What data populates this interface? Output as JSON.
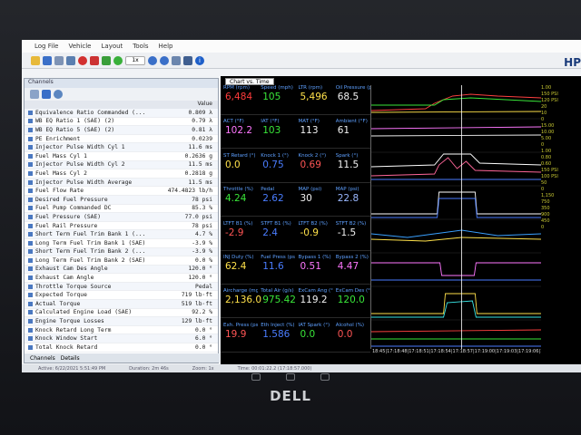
{
  "menu": [
    "Log File",
    "Vehicle",
    "Layout",
    "Tools",
    "Help"
  ],
  "toolbar_icons": [
    "open-icon",
    "save-icon",
    "vehicle-icon",
    "disconnect-icon",
    "record-icon",
    "stop-icon",
    "bookmark-icon",
    "play-icon",
    "speed-icon",
    "zoom-in-icon",
    "zoom-out-icon",
    "chart-icon",
    "layout-icon",
    "info-icon"
  ],
  "toolbar_speed": "1x",
  "app_logo": "HP",
  "channels": {
    "title": "Channels",
    "value_header": "Value",
    "rows": [
      {
        "name": "Equivalence Ratio Commanded (...",
        "value": "0.809 λ"
      },
      {
        "name": "WB EQ Ratio 1 (SAE) (2)",
        "value": "0.79 λ"
      },
      {
        "name": "WB EQ Ratio 5 (SAE) (2)",
        "value": "0.81 λ"
      },
      {
        "name": "PE Enrichment",
        "value": "0.0239"
      },
      {
        "name": "Injector Pulse Width Cyl 1",
        "value": "11.6 ms"
      },
      {
        "name": "Fuel Mass Cyl 1",
        "value": "0.2636 g"
      },
      {
        "name": "Injector Pulse Width Cyl 2",
        "value": "11.5 ms"
      },
      {
        "name": "Fuel Mass Cyl 2",
        "value": "0.2818 g"
      },
      {
        "name": "Injector Pulse Width Average",
        "value": "11.5 ms"
      },
      {
        "name": "Fuel Flow Rate",
        "value": "474.4823 lb/h"
      },
      {
        "name": "Desired Fuel Pressure",
        "value": "78 psi"
      },
      {
        "name": "Fuel Pump Commanded DC",
        "value": "85.3 %"
      },
      {
        "name": "Fuel Pressure (SAE)",
        "value": "77.0 psi"
      },
      {
        "name": "Fuel Rail Pressure",
        "value": "78 psi"
      },
      {
        "name": "Short Term Fuel Trim Bank 1 (...",
        "value": "4.7 %"
      },
      {
        "name": "Long Term Fuel Trim Bank 1 (SAE)",
        "value": "-3.9 %"
      },
      {
        "name": "Short Term Fuel Trim Bank 2 (...",
        "value": "-3.9 %"
      },
      {
        "name": "Long Term Fuel Trim Bank 2 (SAE)",
        "value": "0.0 %"
      },
      {
        "name": "Exhaust Cam Des Angle",
        "value": "120.0 °"
      },
      {
        "name": "Exhaust Cam Angle",
        "value": "120.0 °"
      },
      {
        "name": "Throttle Torque Source",
        "value": "Pedal"
      },
      {
        "name": "Expected Torque",
        "value": "719 lb·ft"
      },
      {
        "name": "Actual Torque",
        "value": "519 lb·ft"
      },
      {
        "name": "Calculated Engine Load (SAE)",
        "value": "92.2 %"
      },
      {
        "name": "Engine Torque Losses",
        "value": "129 lb·ft"
      },
      {
        "name": "Knock Retard Long Term",
        "value": "0.0 °"
      },
      {
        "name": "Knock Window Start",
        "value": "6.0 °"
      },
      {
        "name": "Total Knock Retard",
        "value": "0.0 °"
      }
    ],
    "tabs": [
      "Channels",
      "Details"
    ]
  },
  "chart_tab": "Chart vs. Time",
  "gauges": [
    [
      {
        "label": "RPM (rpm)",
        "value": "6,484",
        "color": "#ff3b3b"
      },
      {
        "label": "Speed (mph)",
        "value": "105",
        "color": "#39e639"
      },
      {
        "label": "LTR (rpm)",
        "value": "5,496",
        "color": "#ffe14a"
      },
      {
        "label": "Oil Pressure (psi)",
        "value": "68.5",
        "color": "#f2f2f2"
      }
    ],
    [
      {
        "label": "ACT (°F)",
        "value": "102.2",
        "color": "#ff77ff"
      },
      {
        "label": "IAT (°F)",
        "value": "103",
        "color": "#39e639"
      },
      {
        "label": "MAT (°F)",
        "value": "113",
        "color": "#f2f2f2"
      },
      {
        "label": "Ambient (°F)",
        "value": "61",
        "color": "#f2f2f2"
      }
    ],
    [
      {
        "label": "ST Retard (°)",
        "value": "0.0",
        "color": "#ffe14a"
      },
      {
        "label": "Knock 1 (°)",
        "value": "0.75",
        "color": "#4a7dff"
      },
      {
        "label": "Knock 2 (°)",
        "value": "0.69",
        "color": "#ff5555"
      },
      {
        "label": "Spark (°)",
        "value": "11.5",
        "color": "#f2f2f2"
      }
    ],
    [
      {
        "label": "Throttle (%)",
        "value": "4.24",
        "color": "#39e639"
      },
      {
        "label": "Pedal",
        "value": "2.62",
        "color": "#4a7dff"
      },
      {
        "label": "MAP (psi)",
        "value": "30",
        "color": "#f2f2f2"
      },
      {
        "label": "MAP (psi)",
        "value": "22.8",
        "color": "#9ab8ff"
      }
    ],
    [
      {
        "label": "LTFT B1 (%)",
        "value": "-2.9",
        "color": "#ff5555"
      },
      {
        "label": "STFT B1 (%)",
        "value": "2.4",
        "color": "#4a7dff"
      },
      {
        "label": "LTFT B2 (%)",
        "value": "-0.9",
        "color": "#ffe14a"
      },
      {
        "label": "STFT B2 (%)",
        "value": "-1.5",
        "color": "#f2f2f2"
      }
    ],
    [
      {
        "label": "INJ Duty (%)",
        "value": "62.4",
        "color": "#ffe14a"
      },
      {
        "label": "Fuel Press (psi)",
        "value": "11.6",
        "color": "#4a7dff"
      },
      {
        "label": "Bypass 1 (%)",
        "value": "0.51",
        "color": "#ff77ff"
      },
      {
        "label": "Bypass 2 (%)",
        "value": "4.47",
        "color": "#ff77ff"
      }
    ],
    [
      {
        "label": "Aircharge (mg)",
        "value": "2,136.0",
        "color": "#ffe14a"
      },
      {
        "label": "Total Air (g/s)",
        "value": "975.42",
        "color": "#39e639"
      },
      {
        "label": "ExCam Ang (°)",
        "value": "119.2",
        "color": "#f2f2f2"
      },
      {
        "label": "ExCam Des (°)",
        "value": "120.0",
        "color": "#39e639"
      }
    ],
    [
      {
        "label": "Exh. Press (psi)",
        "value": "19.9",
        "color": "#ff5555"
      },
      {
        "label": "Eth Inject (%)",
        "value": "1.586",
        "color": "#4a7dff"
      },
      {
        "label": "IAT Spark (°)",
        "value": "0.0",
        "color": "#39e639"
      },
      {
        "label": "Alcohol (%)",
        "value": "0.0",
        "color": "#ff5555"
      }
    ]
  ],
  "time_axis": "18:45|17:18:48|17:18:51|17:18:54|17:18:57|17:19:00|17:19:03|17:19:06|17:19:09|17:19",
  "side_labels": [
    "1.00",
    "150 PSI",
    "120 PSI",
    "20",
    "10",
    "0",
    "15.00",
    "10.00",
    "5.00",
    "0",
    "1.00",
    "0.80",
    "0.60",
    "150 PSI",
    "100 PSI",
    "50",
    "0",
    "1,150",
    "750",
    "350",
    "900",
    "450",
    "0"
  ],
  "statusbar": [
    "Active: 6/22/2021 5:51:49 PM",
    "Duration: 2m 46s",
    "Zoom: 1x",
    "Time: 00:01:22.2 (17:18:57.000)"
  ]
}
